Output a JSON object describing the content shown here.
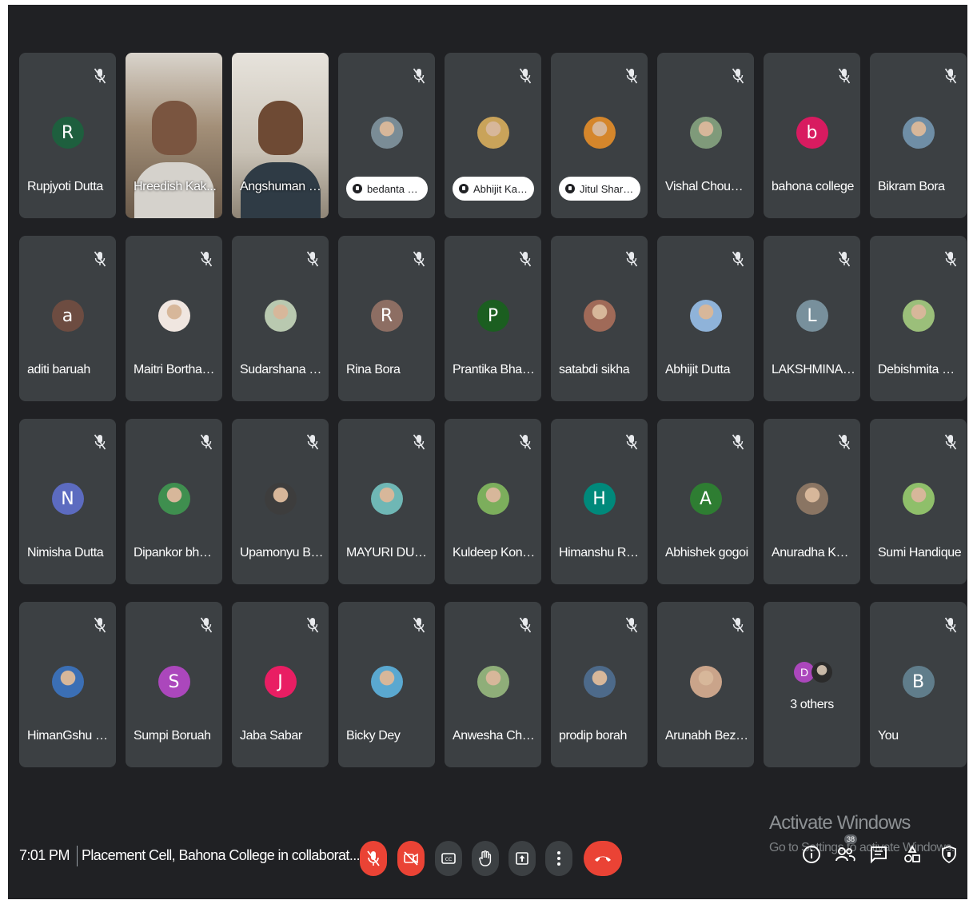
{
  "participants": [
    {
      "name": "Rupjyoti Dutta",
      "initial": "R",
      "color": "#1e5f3e",
      "kind": "initial",
      "muted": true
    },
    {
      "name": "Hreedish Kak...",
      "kind": "video",
      "muted": false
    },
    {
      "name": "Angshuman D...",
      "kind": "video",
      "muted": false
    },
    {
      "name": "bedanta S...",
      "kind": "photo-pill",
      "color": "#7a8c96",
      "muted": true
    },
    {
      "name": "Abhijit Kali...",
      "kind": "photo-pill",
      "color": "#c9a35a",
      "muted": true
    },
    {
      "name": "Jitul Sharma",
      "kind": "photo-pill",
      "color": "#d5862b",
      "muted": true
    },
    {
      "name": "Vishal Choudh...",
      "kind": "photo",
      "color": "#7f9a7a",
      "muted": true
    },
    {
      "name": "bahona college",
      "initial": "b",
      "color": "#d81b60",
      "kind": "initial",
      "muted": true
    },
    {
      "name": "Bikram Bora",
      "kind": "photo",
      "color": "#6f8ea6",
      "muted": true
    },
    {
      "name": "aditi baruah",
      "initial": "a",
      "color": "#6d4c41",
      "kind": "initial",
      "muted": true
    },
    {
      "name": "Maitri Borthakur",
      "kind": "photo",
      "color": "#f0e6e0",
      "muted": true
    },
    {
      "name": "Sudarshana Sar...",
      "kind": "photo",
      "color": "#b9c9b0",
      "muted": true
    },
    {
      "name": "Rina Bora",
      "initial": "R",
      "color": "#8d6e63",
      "kind": "initial",
      "muted": true
    },
    {
      "name": "Prantika Bhatta...",
      "initial": "P",
      "color": "#1b5e20",
      "kind": "initial",
      "muted": true
    },
    {
      "name": "satabdi sikha",
      "kind": "photo",
      "color": "#a06a58",
      "muted": true
    },
    {
      "name": "Abhijit Dutta",
      "kind": "photo",
      "color": "#8fb3d9",
      "muted": true
    },
    {
      "name": "LAKSHMINAND...",
      "initial": "L",
      "color": "#78909c",
      "kind": "initial",
      "muted": true
    },
    {
      "name": "Debishmita Kh...",
      "kind": "photo",
      "color": "#9bbf7a",
      "muted": true
    },
    {
      "name": "Nimisha Dutta",
      "initial": "N",
      "color": "#5c6bc0",
      "kind": "initial",
      "muted": true
    },
    {
      "name": "Dipankor bhatta",
      "kind": "photo",
      "color": "#3f8f4f",
      "muted": true
    },
    {
      "name": "Upamonyu Bor...",
      "kind": "photo",
      "color": "#3d3d3d",
      "muted": true
    },
    {
      "name": "MAYURI DUTTA",
      "kind": "photo",
      "color": "#6fb7b5",
      "muted": true
    },
    {
      "name": "Kuldeep Konwar",
      "kind": "photo",
      "color": "#7cae5c",
      "muted": true
    },
    {
      "name": "Himanshu Rajb...",
      "initial": "H",
      "color": "#00897b",
      "kind": "initial",
      "muted": true
    },
    {
      "name": "Abhishek gogoi",
      "initial": "A",
      "color": "#2e7d32",
      "kind": "initial",
      "muted": true
    },
    {
      "name": "Anuradha Kako...",
      "kind": "photo",
      "color": "#8a7563",
      "muted": true
    },
    {
      "name": "Sumi Handique",
      "kind": "photo",
      "color": "#8fbf6a",
      "muted": true
    },
    {
      "name": "HimanGshu Sai...",
      "kind": "photo",
      "color": "#3b6fb5",
      "muted": true
    },
    {
      "name": "Sumpi Boruah",
      "initial": "S",
      "color": "#ab47bc",
      "kind": "initial",
      "muted": true
    },
    {
      "name": "Jaba Sabar",
      "initial": "J",
      "color": "#e91e63",
      "kind": "initial",
      "muted": true
    },
    {
      "name": "Bicky Dey",
      "kind": "photo",
      "color": "#5aa8d0",
      "muted": true
    },
    {
      "name": "Anwesha Chan...",
      "kind": "photo",
      "color": "#8fae79",
      "muted": true
    },
    {
      "name": "prodip borah",
      "kind": "photo",
      "color": "#4d6a8a",
      "muted": true
    },
    {
      "name": "Arunabh Bezba...",
      "kind": "photo",
      "color": "#caa48a",
      "muted": true
    },
    {
      "name": "3 others",
      "kind": "others",
      "muted": false,
      "mini_initial": "D",
      "mini_color": "#ab47bc"
    },
    {
      "name": "You",
      "initial": "B",
      "color": "#607d8b",
      "kind": "initial",
      "muted": true
    }
  ],
  "footer": {
    "time": "7:01 PM",
    "meeting_title": "Placement Cell, Bahona College in collaborat...",
    "controls": [
      {
        "icon": "mic-off-icon",
        "style": "red"
      },
      {
        "icon": "camera-off-icon",
        "style": "red"
      },
      {
        "icon": "captions-icon",
        "style": "grey"
      },
      {
        "icon": "raise-hand-icon",
        "style": "grey"
      },
      {
        "icon": "present-icon",
        "style": "grey"
      },
      {
        "icon": "more-options-icon",
        "style": "grey"
      },
      {
        "icon": "end-call-icon",
        "style": "end"
      }
    ],
    "right_icons": [
      "info-icon",
      "people-icon",
      "chat-icon",
      "activities-icon",
      "host-controls-icon"
    ],
    "people_count": "38"
  },
  "watermark": {
    "line1": "Activate Windows",
    "line2": "Go to Settings to activate Windows."
  }
}
